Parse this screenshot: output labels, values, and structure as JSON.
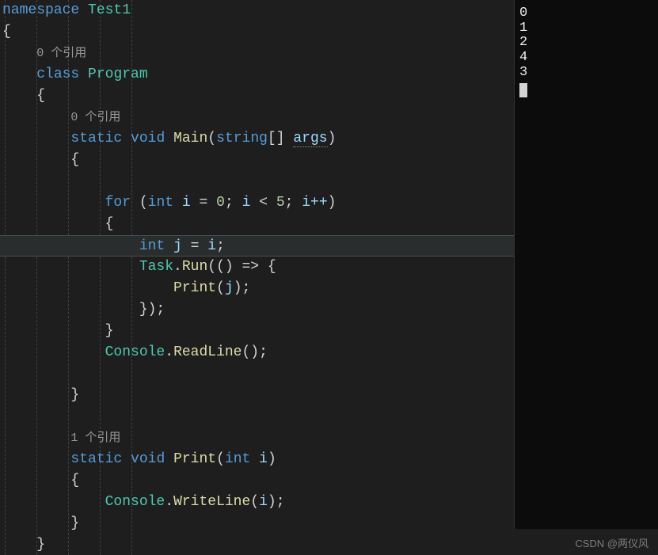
{
  "editor": {
    "tokens": {
      "namespace": "namespace",
      "test1": "Test1",
      "lbrace": "{",
      "rbrace": "}",
      "class": "class",
      "program": "Program",
      "static": "static",
      "void": "void",
      "main": "Main",
      "string": "string",
      "args": "args",
      "for": "for",
      "int": "int",
      "i": "i",
      "eq": "=",
      "zero": "0",
      "semi": ";",
      "lt": "<",
      "five": "5",
      "ipp": "i++",
      "j": "j",
      "task": "Task",
      "run": "Run",
      "lambda": "() => {",
      "print": "Print",
      "readln": "ReadLine",
      "console": "Console",
      "writeln": "WriteLine",
      "lparen": "(",
      "rparen": ")",
      "lbracket": "[",
      "rbracket": "]",
      "dot": ".",
      "comma": ",",
      "closeRunLine": "});"
    },
    "codelens": {
      "ref0": "0 个引用",
      "ref1": "1 个引用"
    }
  },
  "console": {
    "lines": [
      "0",
      "1",
      "2",
      "4",
      "3"
    ]
  },
  "watermark": "CSDN @两仪风"
}
